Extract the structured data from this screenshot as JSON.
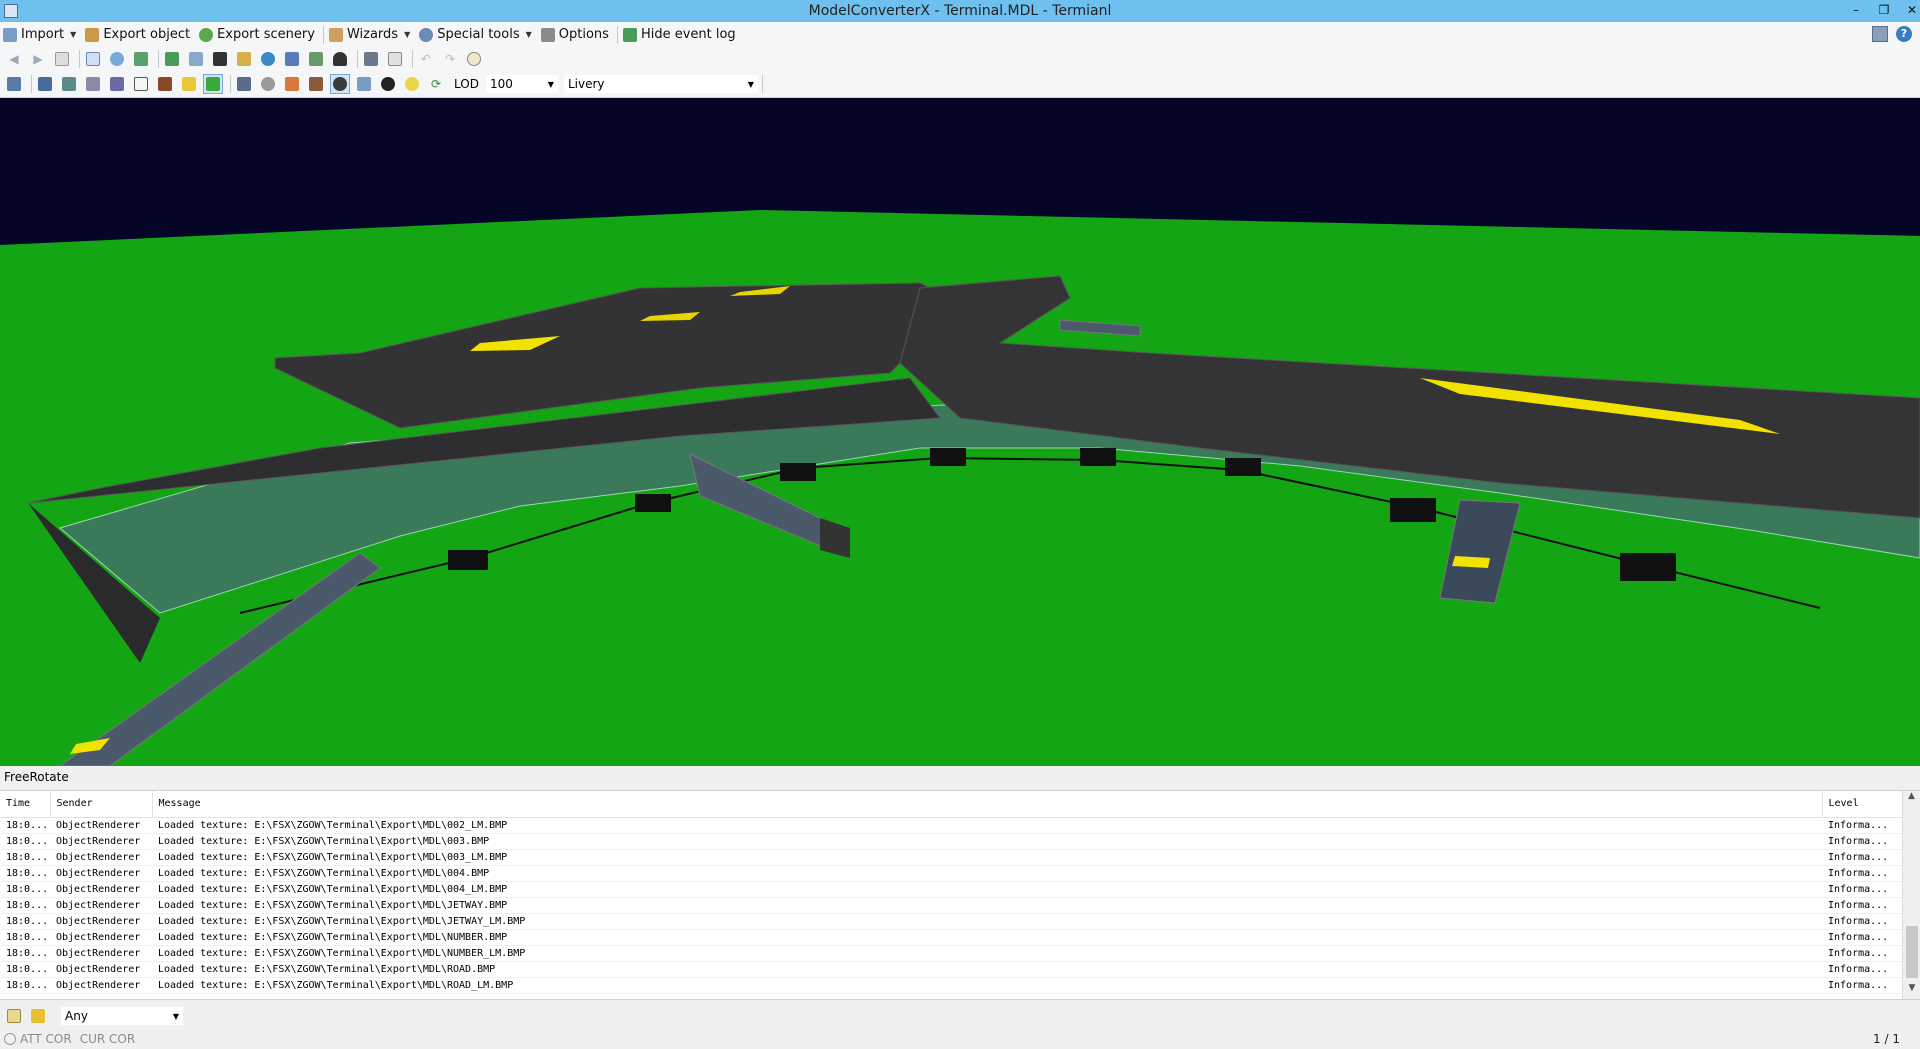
{
  "window": {
    "title": "ModelConverterX - Terminal.MDL - Termianl",
    "minimize": "–",
    "restore": "❐",
    "close": "✕"
  },
  "menubar": {
    "items": [
      {
        "label": "Import",
        "icon": "import-icon",
        "caret": true
      },
      {
        "label": "Export object",
        "icon": "export-object-icon",
        "caret": false
      },
      {
        "label": "Export scenery",
        "icon": "export-scenery-icon",
        "caret": false
      },
      {
        "label": "Wizards",
        "icon": "wizard-wand-icon",
        "caret": true
      },
      {
        "label": "Special tools",
        "icon": "special-tools-gear-icon",
        "caret": true
      },
      {
        "label": "Options",
        "icon": "options-tools-icon",
        "caret": false
      },
      {
        "label": "Hide event log",
        "icon": "event-log-icon",
        "caret": false
      }
    ],
    "help": "?"
  },
  "toolbar2": {
    "lod_label": "LOD",
    "lod_value": "100",
    "livery_value": "Livery"
  },
  "viewport": {
    "mode_label": "FreeRotate",
    "sky_color": "#050527",
    "ground_color": "#14a514"
  },
  "log": {
    "columns": [
      "Time",
      "Sender",
      "Message",
      "Level"
    ],
    "rows": [
      [
        "18:0...",
        "ObjectRenderer",
        "Loaded texture: E:\\FSX\\ZGOW\\Terminal\\Export\\MDL\\002_LM.BMP",
        "Informa..."
      ],
      [
        "18:0...",
        "ObjectRenderer",
        "Loaded texture: E:\\FSX\\ZGOW\\Terminal\\Export\\MDL\\003.BMP",
        "Informa..."
      ],
      [
        "18:0...",
        "ObjectRenderer",
        "Loaded texture: E:\\FSX\\ZGOW\\Terminal\\Export\\MDL\\003_LM.BMP",
        "Informa..."
      ],
      [
        "18:0...",
        "ObjectRenderer",
        "Loaded texture: E:\\FSX\\ZGOW\\Terminal\\Export\\MDL\\004.BMP",
        "Informa..."
      ],
      [
        "18:0...",
        "ObjectRenderer",
        "Loaded texture: E:\\FSX\\ZGOW\\Terminal\\Export\\MDL\\004_LM.BMP",
        "Informa..."
      ],
      [
        "18:0...",
        "ObjectRenderer",
        "Loaded texture: E:\\FSX\\ZGOW\\Terminal\\Export\\MDL\\JETWAY.BMP",
        "Informa..."
      ],
      [
        "18:0...",
        "ObjectRenderer",
        "Loaded texture: E:\\FSX\\ZGOW\\Terminal\\Export\\MDL\\JETWAY_LM.BMP",
        "Informa..."
      ],
      [
        "18:0...",
        "ObjectRenderer",
        "Loaded texture: E:\\FSX\\ZGOW\\Terminal\\Export\\MDL\\NUMBER.BMP",
        "Informa..."
      ],
      [
        "18:0...",
        "ObjectRenderer",
        "Loaded texture: E:\\FSX\\ZGOW\\Terminal\\Export\\MDL\\NUMBER_LM.BMP",
        "Informa..."
      ],
      [
        "18:0...",
        "ObjectRenderer",
        "Loaded texture: E:\\FSX\\ZGOW\\Terminal\\Export\\MDL\\ROAD.BMP",
        "Informa..."
      ],
      [
        "18:0...",
        "ObjectRenderer",
        "Loaded texture: E:\\FSX\\ZGOW\\Terminal\\Export\\MDL\\ROAD_LM.BMP",
        "Informa..."
      ]
    ]
  },
  "filter": {
    "value": "Any"
  },
  "statusbar": {
    "att": "ATT COR",
    "cur": "CUR COR",
    "page": "1 / 1"
  }
}
